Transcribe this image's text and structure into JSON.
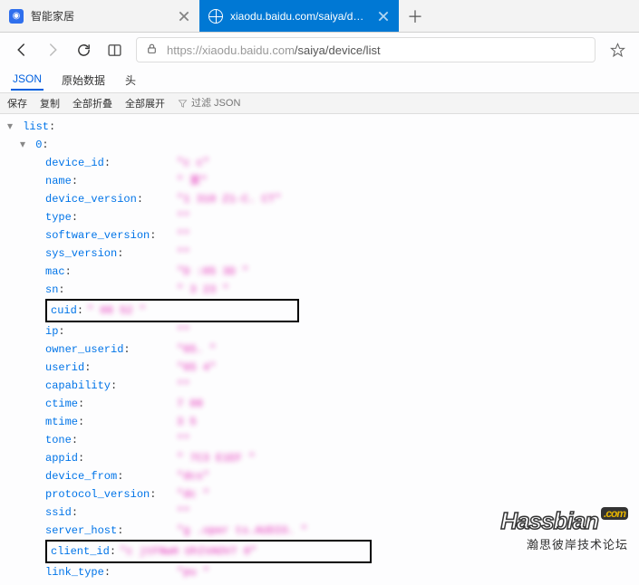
{
  "tabs": [
    {
      "title": "智能家居",
      "active": false
    },
    {
      "title": "xiaodu.baidu.com/saiya/devic",
      "active": true
    }
  ],
  "url": {
    "scheme_host": "https://xiaodu.baidu.com",
    "path": "/saiya/device/list"
  },
  "panel_tabs": {
    "json": "JSON",
    "raw": "原始数据",
    "headers": "头"
  },
  "actions": {
    "save": "保存",
    "copy": "复制",
    "collapse_all": "全部折叠",
    "expand_all": "全部展开",
    "filter_placeholder": "过滤 JSON"
  },
  "tree": {
    "root_key": "list",
    "index_key": "0",
    "fields": {
      "device_id": {
        "k": "device_id",
        "v": "\"c                                                             c\""
      },
      "name": {
        "k": "name",
        "v": "\"             家\""
      },
      "device_version": {
        "k": "device_version",
        "v": "\"1           310     Z1-C.      CT\""
      },
      "type": {
        "k": "type",
        "v": "\"\""
      },
      "software_version": {
        "k": "software_version",
        "v": "\"\""
      },
      "sys_version": {
        "k": "sys_version",
        "v": "\"\""
      },
      "mac": {
        "k": "mac",
        "v": "\"D     :05      3D     \""
      },
      "sn": {
        "k": "sn",
        "v": "\"     3     23 \""
      },
      "cuid": {
        "k": "cuid",
        "v": "\"     08    52       \""
      },
      "ip": {
        "k": "ip",
        "v": "\"\""
      },
      "owner_userid": {
        "k": "owner_userid",
        "v": "\"65.         \""
      },
      "userid": {
        "k": "userid",
        "v": "\"65        4\""
      },
      "capability": {
        "k": "capability",
        "v": "\"\""
      },
      "ctime": {
        "k": "ctime",
        "v": "      7    08"
      },
      "mtime": {
        "k": "mtime",
        "v": "      3     5"
      },
      "tone": {
        "k": "tone",
        "v": "\"\""
      },
      "appid": {
        "k": "appid",
        "v": "\"     7C3     E1EF     \""
      },
      "device_from": {
        "k": "device_from",
        "v": "\"dcs\""
      },
      "protocol_version": {
        "k": "protocol_version",
        "v": "\"dc   \""
      },
      "ssid": {
        "k": "ssid",
        "v": "\"\""
      },
      "server_host": {
        "k": "server_host",
        "v": "\"g    .oper     ts.AUDIO.   \""
      },
      "client_id": {
        "k": "client_id",
        "v": "\"c      jtFNwH      UhIVAOV7       0\""
      },
      "link_type": {
        "k": "link_type",
        "v": "\"pu    \""
      }
    }
  },
  "watermark": {
    "line1_a": "Hassbian",
    "line1_b": ".com",
    "line2": "瀚思彼岸技术论坛"
  }
}
